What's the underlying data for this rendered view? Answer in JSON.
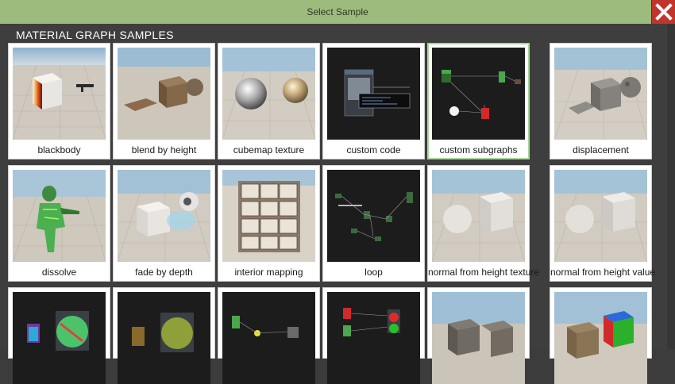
{
  "window": {
    "title": "Select Sample"
  },
  "section": {
    "title": "MATERIAL GRAPH SAMPLES"
  },
  "samples": [
    {
      "label": "blackbody",
      "icon": "blackbody-thumbnail"
    },
    {
      "label": "blend by height",
      "icon": "blend-by-height-thumbnail"
    },
    {
      "label": "cubemap texture",
      "icon": "cubemap-texture-thumbnail"
    },
    {
      "label": "custom code",
      "icon": "custom-code-thumbnail"
    },
    {
      "label": "custom subgraphs",
      "icon": "custom-subgraphs-thumbnail",
      "selected": true
    },
    {
      "label": "displacement",
      "icon": "displacement-thumbnail"
    },
    {
      "label": "dissolve",
      "icon": "dissolve-thumbnail"
    },
    {
      "label": "fade by depth",
      "icon": "fade-by-depth-thumbnail"
    },
    {
      "label": "interior mapping",
      "icon": "interior-mapping-thumbnail"
    },
    {
      "label": "loop",
      "icon": "loop-thumbnail"
    },
    {
      "label": "normal from height texture",
      "icon": "normal-from-height-texture-thumbnail"
    },
    {
      "label": "normal from height value",
      "icon": "normal-from-height-value-thumbnail"
    },
    {
      "label": "",
      "icon": "graph-thumbnail"
    },
    {
      "label": "",
      "icon": "graph-thumbnail"
    },
    {
      "label": "",
      "icon": "graph-thumbnail"
    },
    {
      "label": "",
      "icon": "graph-thumbnail"
    },
    {
      "label": "",
      "icon": "stone-cubes-thumbnail"
    },
    {
      "label": "",
      "icon": "textured-cubes-thumbnail"
    }
  ],
  "colors": {
    "titlebar": "#9dbb7c",
    "close": "#c1342c",
    "background": "#3e3e3e",
    "selected_border": "#a8d89a"
  }
}
